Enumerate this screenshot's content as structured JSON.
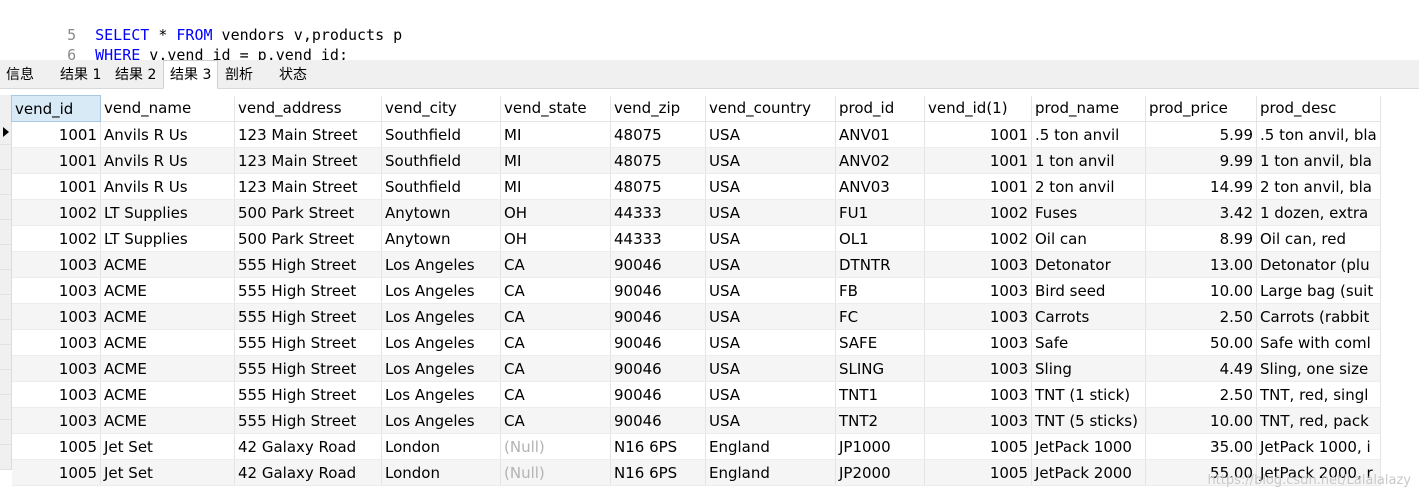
{
  "editor": {
    "lines": [
      {
        "num": "5",
        "kw1": "SELECT",
        "t1": " * ",
        "kw2": "FROM",
        "t2": " vendors v,products p"
      },
      {
        "num": "6",
        "kw1": "WHERE",
        "t1": " v.vend_id = p.vend_id;",
        "kw2": "",
        "t2": ""
      }
    ]
  },
  "tabs": [
    {
      "label": "信息"
    },
    {
      "label": "结果 1"
    },
    {
      "label": "结果 2"
    },
    {
      "label": "结果 3",
      "active": true
    },
    {
      "label": "剖析"
    },
    {
      "label": "状态"
    }
  ],
  "table": {
    "columns": [
      "vend_id",
      "vend_name",
      "vend_address",
      "vend_city",
      "vend_state",
      "vend_zip",
      "vend_country",
      "prod_id",
      "vend_id(1)",
      "prod_name",
      "prod_price",
      "prod_desc"
    ],
    "rows": [
      [
        "1001",
        "Anvils R Us",
        "123 Main Street",
        "Southfield",
        "MI",
        "48075",
        "USA",
        "ANV01",
        "1001",
        ".5 ton anvil",
        "5.99",
        ".5 ton anvil, bla"
      ],
      [
        "1001",
        "Anvils R Us",
        "123 Main Street",
        "Southfield",
        "MI",
        "48075",
        "USA",
        "ANV02",
        "1001",
        "1 ton anvil",
        "9.99",
        "1 ton anvil, bla"
      ],
      [
        "1001",
        "Anvils R Us",
        "123 Main Street",
        "Southfield",
        "MI",
        "48075",
        "USA",
        "ANV03",
        "1001",
        "2 ton anvil",
        "14.99",
        "2 ton anvil, bla"
      ],
      [
        "1002",
        "LT Supplies",
        "500 Park Street",
        "Anytown",
        "OH",
        "44333",
        "USA",
        "FU1",
        "1002",
        "Fuses",
        "3.42",
        "1 dozen, extra"
      ],
      [
        "1002",
        "LT Supplies",
        "500 Park Street",
        "Anytown",
        "OH",
        "44333",
        "USA",
        "OL1",
        "1002",
        "Oil can",
        "8.99",
        "Oil can, red"
      ],
      [
        "1003",
        "ACME",
        "555 High Street",
        "Los Angeles",
        "CA",
        "90046",
        "USA",
        "DTNTR",
        "1003",
        "Detonator",
        "13.00",
        "Detonator (plu"
      ],
      [
        "1003",
        "ACME",
        "555 High Street",
        "Los Angeles",
        "CA",
        "90046",
        "USA",
        "FB",
        "1003",
        "Bird seed",
        "10.00",
        "Large bag (suit"
      ],
      [
        "1003",
        "ACME",
        "555 High Street",
        "Los Angeles",
        "CA",
        "90046",
        "USA",
        "FC",
        "1003",
        "Carrots",
        "2.50",
        "Carrots (rabbit"
      ],
      [
        "1003",
        "ACME",
        "555 High Street",
        "Los Angeles",
        "CA",
        "90046",
        "USA",
        "SAFE",
        "1003",
        "Safe",
        "50.00",
        "Safe with coml"
      ],
      [
        "1003",
        "ACME",
        "555 High Street",
        "Los Angeles",
        "CA",
        "90046",
        "USA",
        "SLING",
        "1003",
        "Sling",
        "4.49",
        "Sling, one size"
      ],
      [
        "1003",
        "ACME",
        "555 High Street",
        "Los Angeles",
        "CA",
        "90046",
        "USA",
        "TNT1",
        "1003",
        "TNT (1 stick)",
        "2.50",
        "TNT, red, singl"
      ],
      [
        "1003",
        "ACME",
        "555 High Street",
        "Los Angeles",
        "CA",
        "90046",
        "USA",
        "TNT2",
        "1003",
        "TNT (5 sticks)",
        "10.00",
        "TNT, red, pack"
      ],
      [
        "1005",
        "Jet Set",
        "42 Galaxy Road",
        "London",
        "(Null)",
        "N16 6PS",
        "England",
        "JP1000",
        "1005",
        "JetPack 1000",
        "35.00",
        "JetPack 1000, i"
      ],
      [
        "1005",
        "Jet Set",
        "42 Galaxy Road",
        "London",
        "(Null)",
        "N16 6PS",
        "England",
        "JP2000",
        "1005",
        "JetPack 2000",
        "55.00",
        "JetPack 2000, r"
      ]
    ]
  },
  "watermark": "https://blog.csdn.net/Lalalalazy"
}
